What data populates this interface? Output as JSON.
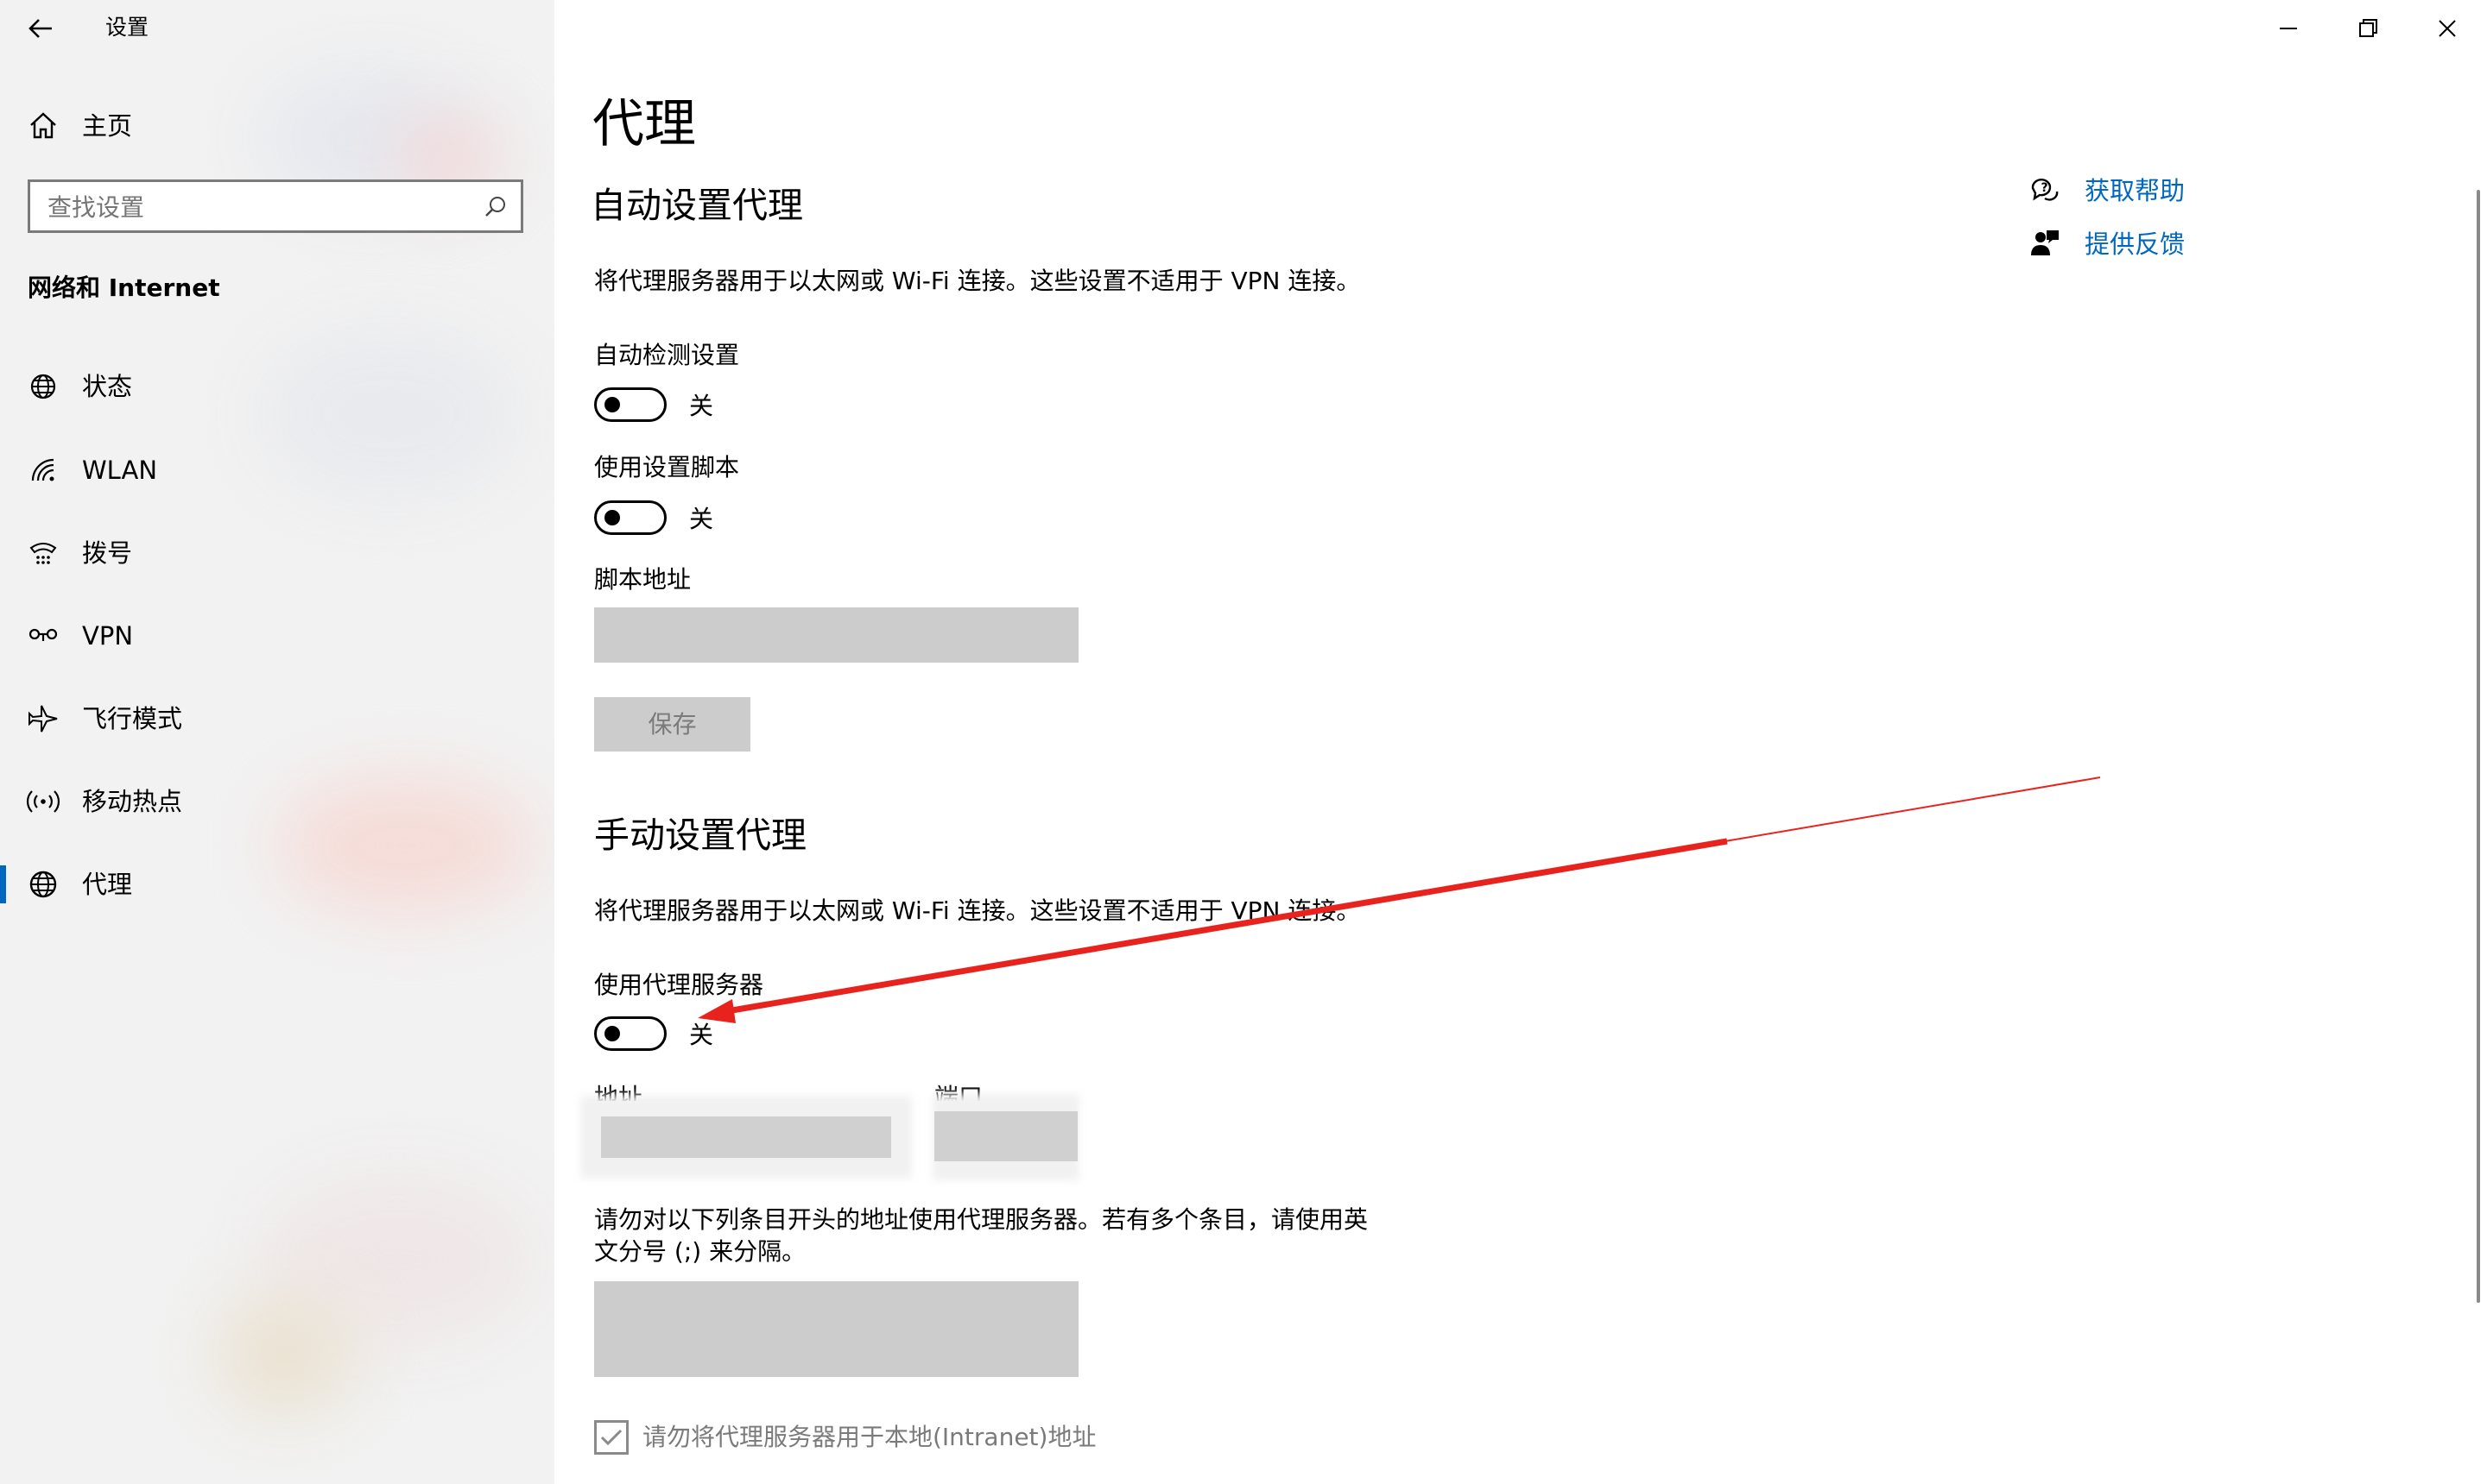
{
  "window": {
    "title": "设置",
    "back_icon": "arrow-left-icon",
    "minimize_icon": "minimize-icon",
    "maximize_icon": "restore-icon",
    "close_icon": "close-icon"
  },
  "sidebar": {
    "home_label": "主页",
    "search_placeholder": "查找设置",
    "category": "网络和 Internet",
    "items": [
      {
        "label": "状态",
        "icon": "globe-status-icon"
      },
      {
        "label": "WLAN",
        "icon": "wifi-icon"
      },
      {
        "label": "拨号",
        "icon": "dialup-icon"
      },
      {
        "label": "VPN",
        "icon": "vpn-icon"
      },
      {
        "label": "飞行模式",
        "icon": "airplane-icon"
      },
      {
        "label": "移动热点",
        "icon": "hotspot-icon"
      },
      {
        "label": "代理",
        "icon": "globe-icon",
        "active": true
      }
    ],
    "accent": "#0067c0"
  },
  "main": {
    "title": "代理",
    "auto": {
      "heading": "自动设置代理",
      "description": "将代理服务器用于以太网或 Wi-Fi 连接。这些设置不适用于 VPN 连接。",
      "detect_label": "自动检测设置",
      "detect_state": "关",
      "script_label": "使用设置脚本",
      "script_state": "关",
      "address_label": "脚本地址",
      "save_label": "保存"
    },
    "manual": {
      "heading": "手动设置代理",
      "description": "将代理服务器用于以太网或 Wi-Fi 连接。这些设置不适用于 VPN 连接。",
      "use_proxy_label": "使用代理服务器",
      "use_proxy_state": "关",
      "address_label": "地址",
      "port_label": "端口",
      "exceptions_line1": "请勿对以下列条目开头的地址使用代理服务器。若有多个条目，请使用英",
      "exceptions_line2": "文分号 (;) 来分隔。",
      "local_checkbox_label": "请勿将代理服务器用于本地(Intranet)地址"
    },
    "help": {
      "get_help": "获取帮助",
      "feedback": "提供反馈"
    },
    "annotation_color": "#e8231d"
  }
}
